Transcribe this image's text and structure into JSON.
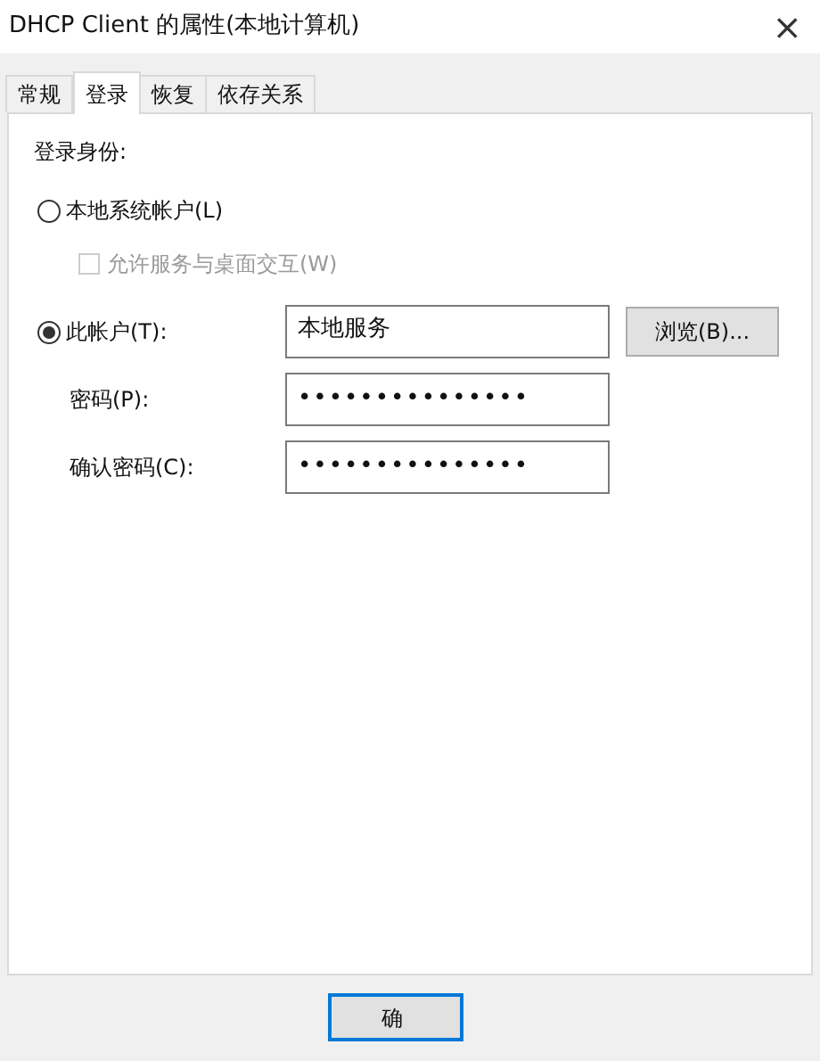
{
  "window": {
    "title": "DHCP Client 的属性(本地计算机)",
    "close": "×"
  },
  "tabs": [
    {
      "label": "常规",
      "selected": false
    },
    {
      "label": "登录",
      "selected": true
    },
    {
      "label": "恢复",
      "selected": false
    },
    {
      "label": "依存关系",
      "selected": false
    }
  ],
  "logon": {
    "heading": "登录身份:",
    "local_system": {
      "label": "本地系统帐户(L)",
      "selected": false
    },
    "interact": {
      "label": "允许服务与桌面交互(W)",
      "checked": false,
      "disabled": true
    },
    "this_account": {
      "label": "此帐户(T):",
      "selected": true,
      "value": "本地服务",
      "browse": "浏览(B)..."
    },
    "password": {
      "label": "密码(P):",
      "value": "•••••••••••••••"
    },
    "confirm": {
      "label": "确认密码(C):",
      "value": "•••••••••••••••"
    }
  },
  "buttons": [
    "确"
  ]
}
